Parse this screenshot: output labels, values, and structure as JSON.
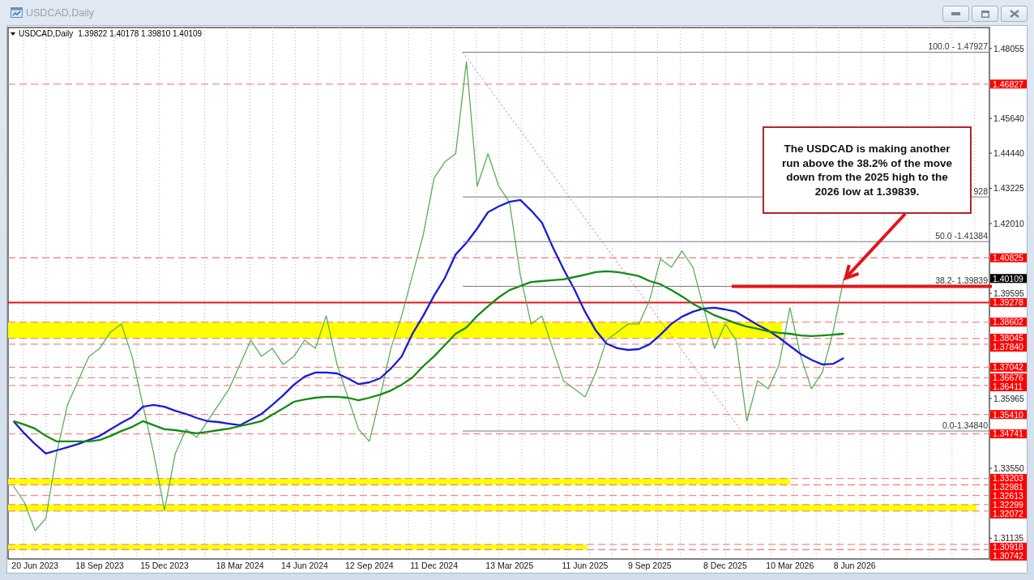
{
  "window": {
    "title": "USDCAD,Daily"
  },
  "chart": {
    "header": {
      "symbol": "USDCAD,Daily",
      "values": [
        "1.39822",
        "1.40178",
        "1.39810",
        "1.40109"
      ]
    },
    "chart_data": {
      "type": "line",
      "ylim": [
        1.3042,
        1.4878
      ],
      "categories": [
        null,
        null,
        "20 Jun 2023",
        null,
        null,
        null,
        null,
        null,
        "18 Sep 2023",
        null,
        null,
        null,
        null,
        null,
        "15 Dec 2023",
        null,
        null,
        null,
        null,
        null,
        null,
        "18 Mar 2024",
        null,
        null,
        null,
        null,
        null,
        "14 Jun 2024",
        null,
        null,
        null,
        null,
        null,
        "12 Sep 2024",
        null,
        null,
        null,
        null,
        null,
        "11 Dec 2024",
        null,
        null,
        null,
        null,
        null,
        null,
        "13 Mar 2025",
        null,
        null,
        null,
        null,
        null,
        null,
        "11 Jun 2025",
        null,
        null,
        null,
        null,
        null,
        "9 Sep 2025",
        null,
        null,
        null,
        null,
        null,
        null,
        "8 Dec 2025",
        null,
        null,
        null,
        null,
        null,
        "10 Mar 2026",
        null,
        null,
        null,
        null,
        null,
        "8 Jun 2026",
        null,
        null,
        null,
        null,
        null,
        null,
        null,
        null,
        null,
        null,
        null,
        null
      ],
      "yticks": [
        {
          "value": 1.48055,
          "label": "1.48055"
        },
        {
          "value": 1.4564,
          "label": "1.45640"
        },
        {
          "value": 1.4444,
          "label": "1.44440"
        },
        {
          "value": 1.43225,
          "label": "1.43225"
        },
        {
          "value": 1.4201,
          "label": "1.42010"
        },
        {
          "value": 1.39595,
          "label": "1.39595"
        },
        {
          "value": 1.35965,
          "label": "1.35965"
        },
        {
          "value": 1.3355,
          "label": "1.33550"
        },
        {
          "value": 1.31135,
          "label": "1.31135"
        }
      ],
      "series": [
        {
          "color": "#5aae5a",
          "values": [
            1.3294,
            1.3238,
            1.314,
            1.3182,
            1.3406,
            1.3574,
            1.3658,
            1.3742,
            1.377,
            1.3826,
            1.3854,
            1.3742,
            1.3574,
            1.3406,
            1.321,
            1.3406,
            1.349,
            1.3462,
            1.3518,
            1.3574,
            1.363,
            1.3714,
            1.3798,
            1.3742,
            1.377,
            1.3714,
            1.3742,
            1.3798,
            1.377,
            1.3882,
            1.3714,
            1.3602,
            1.349,
            1.3448,
            1.3602,
            1.377,
            1.3882,
            1.4022,
            1.4162,
            1.4358,
            1.4414,
            1.4442,
            1.476,
            1.433,
            1.4442,
            1.433,
            1.4274,
            1.4022,
            1.3854,
            1.3882,
            1.377,
            1.3658,
            1.363,
            1.3602,
            1.3686,
            1.3798,
            1.3826,
            1.3854,
            1.3854,
            1.3938,
            1.4078,
            1.405,
            1.4106,
            1.405,
            1.391,
            1.377,
            1.3854,
            1.3798,
            1.3518,
            1.3658,
            1.363,
            1.3714,
            1.391,
            1.3742,
            1.363,
            1.3686,
            1.3826,
            1.4011,
            null,
            null,
            null,
            null,
            null,
            null,
            null,
            null,
            null,
            null,
            null,
            null,
            null
          ]
        },
        {
          "color": "#1c1cd6",
          "values": [
            1.3518,
            1.3476,
            1.3439,
            1.3406,
            1.3417,
            1.3428,
            1.3439,
            1.3453,
            1.3467,
            1.349,
            1.3512,
            1.3532,
            1.3568,
            1.3574,
            1.3568,
            1.3554,
            1.3543,
            1.3529,
            1.3518,
            1.3515,
            1.3509,
            1.3504,
            1.3523,
            1.3543,
            1.3574,
            1.3607,
            1.3644,
            1.3672,
            1.3686,
            1.3686,
            1.3683,
            1.3666,
            1.3646,
            1.3652,
            1.3666,
            1.37,
            1.3742,
            1.382,
            1.3882,
            1.3952,
            1.4013,
            1.4094,
            1.4134,
            1.4184,
            1.424,
            1.426,
            1.4276,
            1.4282,
            1.4246,
            1.4204,
            1.412,
            1.4044,
            1.3974,
            1.3896,
            1.3831,
            1.3786,
            1.377,
            1.3764,
            1.3767,
            1.3784,
            1.3817,
            1.3854,
            1.3879,
            1.3896,
            1.3907,
            1.391,
            1.3904,
            1.3896,
            1.3873,
            1.3851,
            1.3831,
            1.3806,
            1.3778,
            1.375,
            1.373,
            1.3714,
            1.3716,
            1.3736,
            null,
            null,
            null,
            null,
            null,
            null,
            null,
            null,
            null,
            null,
            null,
            null,
            null
          ]
        },
        {
          "color": "#118c11",
          "values": [
            1.3518,
            1.3506,
            1.3492,
            1.3467,
            1.3448,
            1.3448,
            1.3448,
            1.3448,
            1.3453,
            1.3467,
            1.3484,
            1.3498,
            1.3518,
            1.3504,
            1.349,
            1.3487,
            1.3481,
            1.3476,
            1.3481,
            1.3487,
            1.3492,
            1.3501,
            1.3509,
            1.3518,
            1.354,
            1.3562,
            1.3585,
            1.3593,
            1.3599,
            1.3602,
            1.3602,
            1.3599,
            1.359,
            1.3599,
            1.361,
            1.3624,
            1.3644,
            1.3669,
            1.3708,
            1.3742,
            1.3781,
            1.382,
            1.3842,
            1.3882,
            1.3915,
            1.3946,
            1.3971,
            1.3985,
            1.3999,
            1.4002,
            1.4005,
            1.4008,
            1.4016,
            1.4024,
            1.4033,
            1.4036,
            1.4033,
            1.4027,
            1.4019,
            1.4002,
            1.3991,
            1.3971,
            1.3949,
            1.3924,
            1.3904,
            1.3884,
            1.387,
            1.3856,
            1.3845,
            1.3837,
            1.3828,
            1.3823,
            1.382,
            1.3814,
            1.3812,
            1.3814,
            1.3817,
            1.382,
            null,
            null,
            null,
            null,
            null,
            null,
            null,
            null,
            null,
            null,
            null,
            null,
            null
          ]
        }
      ],
      "ref_lines": [
        {
          "axis": "y",
          "value": 1.46827,
          "label": "1.46827",
          "color": "#f08c8c"
        },
        {
          "axis": "y",
          "value": 1.40825,
          "label": "1.40825",
          "color": "#f08c8c"
        },
        {
          "axis": "y",
          "value": 1.39278,
          "label": "1.39278",
          "color": "#e3141b"
        },
        {
          "axis": "y",
          "value": 1.38602,
          "label": "1.38602",
          "color": "#f08c8c"
        },
        {
          "axis": "y",
          "value": 1.38045,
          "label": "1.38045",
          "color": "#f08c8c"
        },
        {
          "axis": "y",
          "value": 1.3784,
          "label": "1.37840",
          "color": "#f08c8c"
        },
        {
          "axis": "y",
          "value": 1.37042,
          "label": "1.37042",
          "color": "#f08c8c"
        },
        {
          "axis": "y",
          "value": 1.36676,
          "label": "1.36676",
          "color": "#f08c8c"
        },
        {
          "axis": "y",
          "value": 1.36411,
          "label": "1.36411",
          "color": "#f08c8c"
        },
        {
          "axis": "y",
          "value": 1.3541,
          "label": "1.35410",
          "color": "#f08c8c"
        },
        {
          "axis": "y",
          "value": 1.34741,
          "label": "1.34741",
          "color": "#f08c8c"
        },
        {
          "axis": "y",
          "value": 1.33203,
          "label": "1.33203",
          "color": "#f08c8c"
        },
        {
          "axis": "y",
          "value": 1.32981,
          "label": "1.32981",
          "color": "#f08c8c"
        },
        {
          "axis": "y",
          "value": 1.32613,
          "label": "1.32613",
          "color": "#f08c8c"
        },
        {
          "axis": "y",
          "value": 1.32299,
          "label": "1.32299",
          "color": "#f08c8c"
        },
        {
          "axis": "y",
          "value": 1.32072,
          "label": "1.32072",
          "color": "#f08c8c"
        },
        {
          "axis": "y",
          "value": 1.30918,
          "label": "1.30918",
          "color": "#f08c8c"
        },
        {
          "axis": "y",
          "value": 1.30742,
          "label": "1.30742",
          "color": "#f08c8c"
        }
      ],
      "bands": [
        {
          "axis": "y",
          "from": 1.38045,
          "to": 1.38602
        },
        {
          "axis": "y",
          "from": 1.32981,
          "to": 1.33203
        },
        {
          "axis": "y",
          "from": 1.32072,
          "to": 1.32299
        },
        {
          "axis": "y",
          "from": 1.30742,
          "to": 1.30918
        }
      ]
    },
    "fibonacci": {
      "labels": [
        "100.0 - 1.47927",
        "928",
        "50.0 -1.41384",
        "38.2- 1.39839",
        "0.0-1.34840"
      ]
    },
    "note": {
      "text": "The USDCAD is making another run above the 38.2% of the move down from the 2025 high to the 2026 low at 1.39839."
    },
    "current_price": "1.40109"
  }
}
